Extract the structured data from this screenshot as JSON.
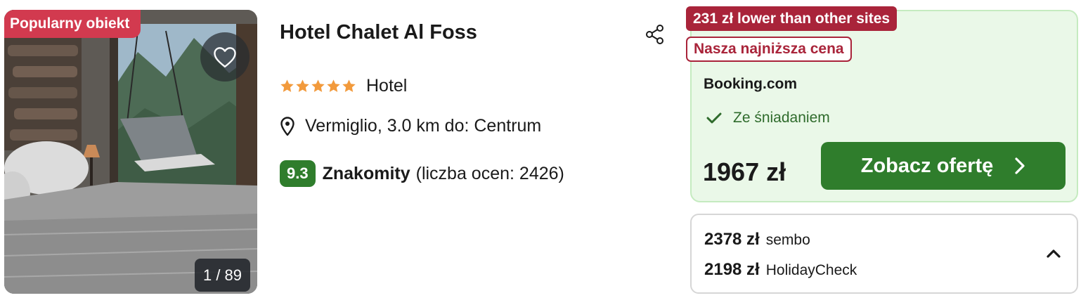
{
  "photo": {
    "badge": "Popularny obiekt",
    "counter": "1 / 89",
    "favorite_icon": "heart-icon"
  },
  "hotel": {
    "name": "Hotel Chalet Al Foss",
    "share_icon": "share-icon",
    "stars": 5,
    "type": "Hotel",
    "location": "Vermiglio, 3.0 km do: Centrum",
    "location_icon": "map-pin-icon",
    "score": "9.3",
    "rating_word": "Znakomity",
    "rating_count": "(liczba ocen: 2426)"
  },
  "deal": {
    "savings_tag": "231 zł lower than other sites",
    "lowest_tag": "Nasza najniższa cena",
    "provider": "Booking.com",
    "perk": "Ze śniadaniem",
    "perk_icon": "check-icon",
    "price": "1967 zł",
    "cta_label": "Zobacz ofertę",
    "cta_icon": "chevron-right-icon"
  },
  "other_offers": [
    {
      "price": "2378 zł",
      "provider": "sembo"
    },
    {
      "price": "2198 zł",
      "provider": "HolidayCheck"
    }
  ],
  "other_offers_toggle_icon": "chevron-up-icon",
  "colors": {
    "badge_red": "#d23a4f",
    "tag_red": "#a9243a",
    "brand_green": "#2f7d2c",
    "deal_bg": "#eaf8e8",
    "star_orange": "#f29a3c"
  }
}
